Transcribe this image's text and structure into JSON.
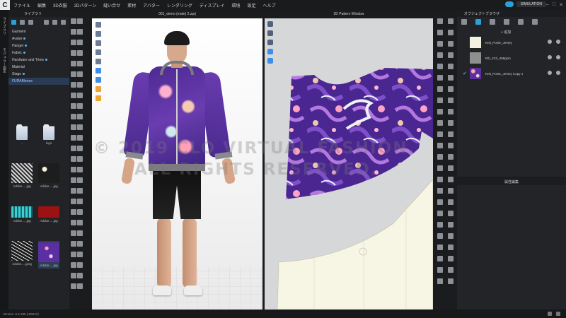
{
  "app": {
    "logo": "C",
    "menu": [
      "ファイル",
      "編集",
      "3D衣服",
      "2Dパターン",
      "縫い合せ",
      "素材",
      "アバター",
      "レンダリング",
      "ディスプレイ",
      "環境",
      "設定",
      "ヘルプ"
    ],
    "simulation_label": "SIMULATION",
    "window_controls": [
      "–",
      "□",
      "✕"
    ]
  },
  "side_tabs": [
    "ライブラリ",
    "モジュラー設定"
  ],
  "library": {
    "title": "ライブラリ",
    "tree": [
      {
        "label": "Garment",
        "dot": false
      },
      {
        "label": "Avatar",
        "dot": true
      },
      {
        "label": "Hanger",
        "dot": true
      },
      {
        "label": "Fabric",
        "dot": true
      },
      {
        "label": "Hardware and Trims",
        "dot": true
      },
      {
        "label": "Material",
        "dot": false
      },
      {
        "label": "Stage",
        "dot": true
      },
      {
        "label": "FURAMeeee",
        "dot": false,
        "selected": true
      }
    ],
    "thumbnails": [
      {
        "caption": "..",
        "type": "folder"
      },
      {
        "caption": "logs",
        "type": "folder"
      },
      {
        "caption": "Adobe.....jpg",
        "type": "bw"
      },
      {
        "caption": "Adobe.....jpg",
        "type": "flower"
      },
      {
        "caption": "Adobe.....jpg",
        "type": "teal"
      },
      {
        "caption": "Adobe.....jpg",
        "type": "red"
      },
      {
        "caption": "Adobe.....jpeg",
        "type": "dark"
      },
      {
        "caption": "Adobe.....jpg",
        "type": "purple",
        "selected": true
      }
    ]
  },
  "viewport_3d": {
    "title": "001_demo (male) 2.zprj"
  },
  "viewport_2d": {
    "title": "2D Pattern Window"
  },
  "watermark": {
    "line1": "© 2019 CLO VIRTUAL FASHION.",
    "line2": "ALL RIGHTS RESERVED."
  },
  "object_browser": {
    "title": "オブジェクトブラウザ",
    "add_label": "+ 追加",
    "fabrics": [
      {
        "name": "Knit_Ponte_Jersey",
        "swatch": "#f4f1e3",
        "checked": false
      },
      {
        "name": "Rib_2X2_468gsm",
        "swatch": "#8f8f8f",
        "checked": false
      },
      {
        "name": "Knit_Ponte_Jersey Copy 1",
        "swatch": "#5b2f9c",
        "checked": true
      }
    ]
  },
  "property_editor": {
    "title": "属性編集"
  },
  "status": {
    "version": "Version: 6.2.285 (r36047)"
  },
  "colors": {
    "accent": "#2ba0d8",
    "panel": "#232427",
    "fabric_purple": "#5b2f9c",
    "pattern_cream": "#f7f5e4"
  }
}
